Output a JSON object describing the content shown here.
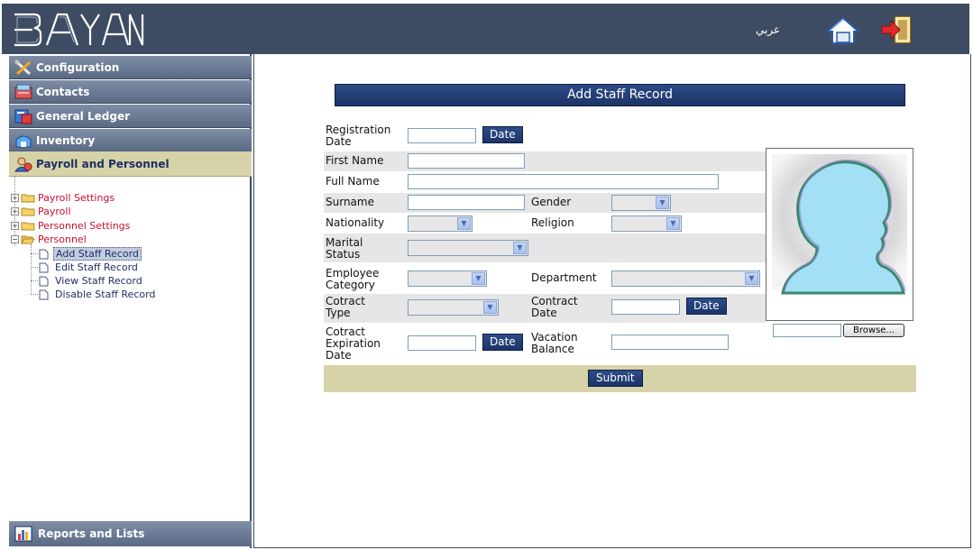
{
  "header": {
    "logo_text": "BAYAN",
    "language_link": "عربي",
    "home_icon": "home-icon",
    "logout_icon": "logout-icon"
  },
  "sidebar": {
    "nav": [
      {
        "label": "Configuration",
        "icon": "tools-icon"
      },
      {
        "label": "Contacts",
        "icon": "contacts-icon"
      },
      {
        "label": "General Ledger",
        "icon": "ledger-icon"
      },
      {
        "label": "Inventory",
        "icon": "inventory-icon"
      },
      {
        "label": "Payroll and Personnel",
        "icon": "payroll-icon",
        "active": true
      }
    ],
    "tree": {
      "folders": [
        {
          "label": "Payroll Settings",
          "expanded": false
        },
        {
          "label": "Payroll",
          "expanded": false
        },
        {
          "label": "Personnel Settings",
          "expanded": false
        },
        {
          "label": "Personnel",
          "expanded": true
        }
      ],
      "personnel_items": [
        {
          "label": "Add Staff Record",
          "selected": true
        },
        {
          "label": "Edit Staff Record"
        },
        {
          "label": "View Staff Record"
        },
        {
          "label": "Disable Staff Record"
        }
      ]
    },
    "reports": {
      "label": "Reports and Lists",
      "icon": "chart-icon"
    }
  },
  "form": {
    "title": "Add Staff Record",
    "date_button": "Date",
    "fields": {
      "registration_date": {
        "label": "Registration Date",
        "value": ""
      },
      "first_name": {
        "label": "First Name",
        "value": ""
      },
      "full_name": {
        "label": "Full Name",
        "value": ""
      },
      "surname": {
        "label": "Surname",
        "value": ""
      },
      "gender": {
        "label": "Gender",
        "value": ""
      },
      "nationality": {
        "label": "Nationality",
        "value": ""
      },
      "religion": {
        "label": "Religion",
        "value": ""
      },
      "marital_status": {
        "label": "Marital Status",
        "value": ""
      },
      "employee_category": {
        "label": "Employee Category",
        "value": ""
      },
      "department": {
        "label": "Department",
        "value": ""
      },
      "contract_type": {
        "label": "Cotract Type",
        "value": ""
      },
      "contract_date": {
        "label": "Contract Date",
        "value": ""
      },
      "contract_expiration_date": {
        "label": "Cotract Expiration Date",
        "value": ""
      },
      "vacation_balance": {
        "label": "Vacation Balance",
        "value": ""
      }
    },
    "submit_label": "Submit",
    "browse_label": "Browse...",
    "file_value": ""
  },
  "colors": {
    "header_bg": "#3e4c63",
    "accent_blue": "#1e3466",
    "active_tan": "#d6d3a8",
    "tree_red": "#c8102e",
    "silhouette": "#a3dff5"
  }
}
